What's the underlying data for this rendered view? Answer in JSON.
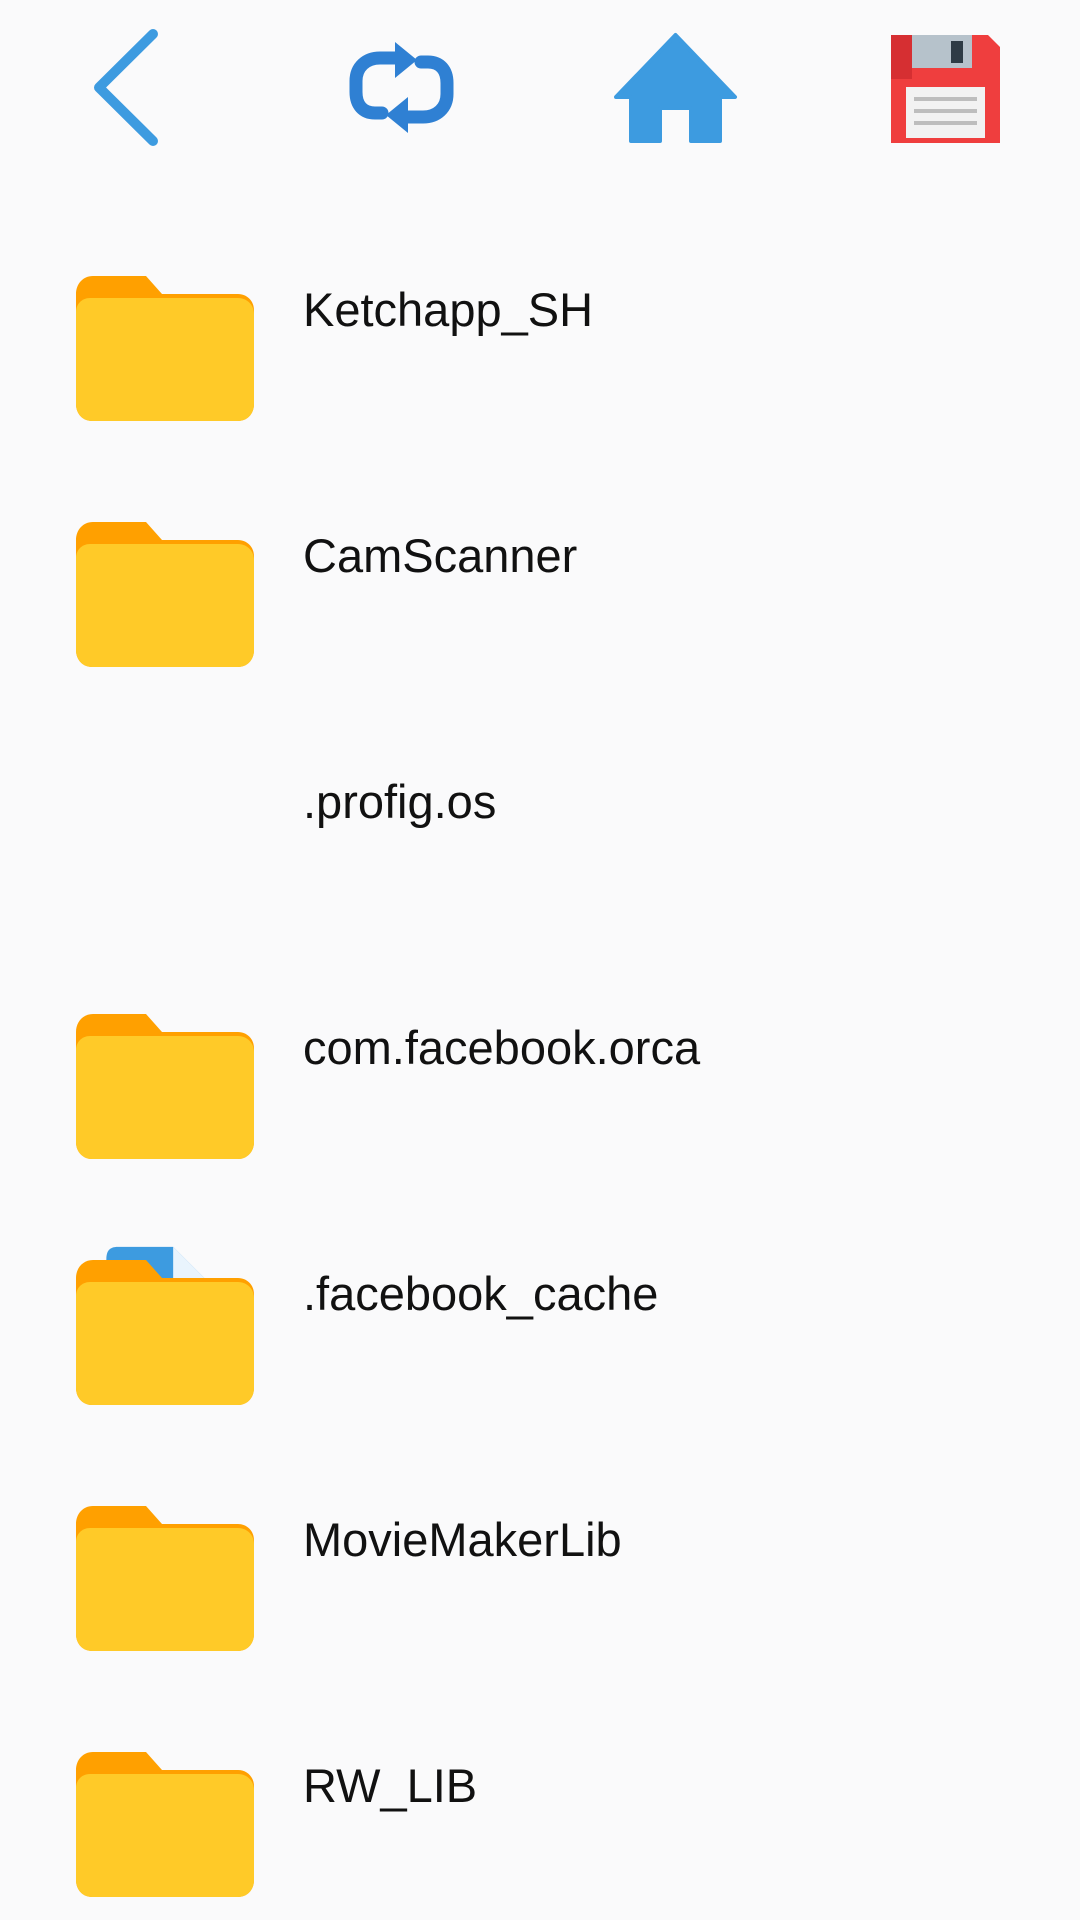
{
  "colors": {
    "background": "#fafafb",
    "toolbar_blue": "#3d9be0",
    "folder_yellow": "#ffca28",
    "folder_tab": "#ffa000",
    "file_blue": "#3d9be0",
    "save_red": "#ef3e3e",
    "text": "#111111"
  },
  "toolbar": {
    "back_icon": "chevron-left-icon",
    "refresh_icon": "refresh-icon",
    "home_icon": "home-icon",
    "save_icon": "floppy-disk-icon"
  },
  "items": [
    {
      "name": "Ketchapp_SH",
      "icon": "folder-icon"
    },
    {
      "name": "CamScanner",
      "icon": "folder-icon"
    },
    {
      "name": ".profig.os",
      "icon": "file-icon"
    },
    {
      "name": "com.facebook.orca",
      "icon": "folder-icon"
    },
    {
      "name": ".facebook_cache",
      "icon": "folder-icon"
    },
    {
      "name": "MovieMakerLib",
      "icon": "folder-icon"
    },
    {
      "name": "RW_LIB",
      "icon": "folder-icon"
    }
  ]
}
